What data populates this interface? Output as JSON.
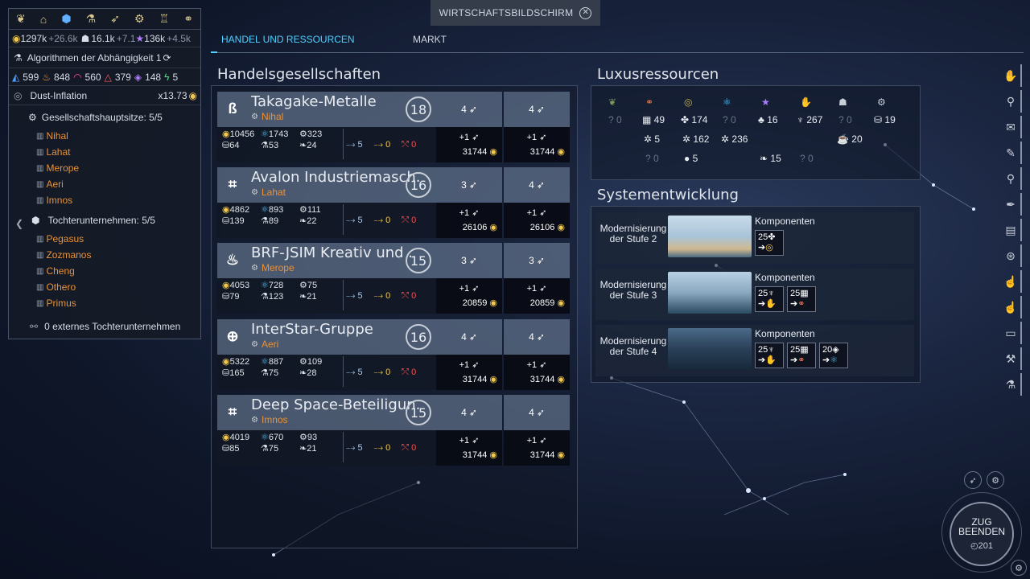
{
  "top_title": "WIRTSCHAFTSBILDSCHIRM",
  "tabs": [
    {
      "label": "HANDEL UND RESSOURCEN",
      "active": true
    },
    {
      "label": "MARKT",
      "active": false
    }
  ],
  "left_panel": {
    "top_icons": [
      "laurel-icon",
      "building-icon",
      "hexagon-icon",
      "flask-icon",
      "ship-icon",
      "gear-icon",
      "trophy-icon",
      "handshake-icon"
    ],
    "economy": {
      "dust": "1297k",
      "dust_delta": "+26.6k",
      "pop": "16.1k",
      "pop_delta": "+7.1",
      "influence": "136k",
      "influence_delta": "+4.5k"
    },
    "research": {
      "label": "Algorithmen der Abhängigkeit 1"
    },
    "strategic": [
      "599",
      "848",
      "560",
      "379",
      "148",
      "5"
    ],
    "inflation": {
      "label": "Dust-Inflation",
      "value": "x13.73"
    },
    "hq_section": {
      "title": "Gesellschaftshauptsitze: 5/5",
      "items": [
        "Nihal",
        "Lahat",
        "Merope",
        "Aeri",
        "Imnos"
      ]
    },
    "sub_section": {
      "title": "Tochterunternehmen: 5/5",
      "items": [
        "Pegasus",
        "Zozmanos",
        "Cheng",
        "Othero",
        "Primus"
      ]
    },
    "external": "0 externes Tochterunternehmen"
  },
  "companies_title": "Handelsgesellschaften",
  "companies": [
    {
      "name": "Takagake-Metalle",
      "hq": "Nihal",
      "level": "18",
      "logo": "ß",
      "stats": [
        "10456",
        "1743",
        "323",
        "64",
        "53",
        "24"
      ],
      "routes": [
        "5",
        "0",
        "0"
      ],
      "trade": [
        {
          "head": "4",
          "delta": "+1",
          "value": "31744"
        },
        {
          "head": "4",
          "delta": "+1",
          "value": "31744"
        }
      ]
    },
    {
      "name": "Avalon Industriemasch.",
      "hq": "Lahat",
      "level": "16",
      "logo": "⌗",
      "stats": [
        "4862",
        "893",
        "111",
        "139",
        "89",
        "22"
      ],
      "routes": [
        "5",
        "0",
        "0"
      ],
      "trade": [
        {
          "head": "3",
          "delta": "+1",
          "value": "26106"
        },
        {
          "head": "4",
          "delta": "+1",
          "value": "26106"
        }
      ]
    },
    {
      "name": "BRF-JSIM Kreativ und .",
      "hq": "Merope",
      "level": "15",
      "logo": "♨",
      "stats": [
        "4053",
        "728",
        "75",
        "79",
        "123",
        "21"
      ],
      "routes": [
        "5",
        "0",
        "0"
      ],
      "trade": [
        {
          "head": "3",
          "delta": "+1",
          "value": "20859"
        },
        {
          "head": "3",
          "delta": "+1",
          "value": "20859"
        }
      ]
    },
    {
      "name": "InterStar-Gruppe",
      "hq": "Aeri",
      "level": "16",
      "logo": "⊕",
      "stats": [
        "5322",
        "887",
        "109",
        "165",
        "75",
        "28"
      ],
      "routes": [
        "5",
        "0",
        "0"
      ],
      "trade": [
        {
          "head": "4",
          "delta": "+1",
          "value": "31744"
        },
        {
          "head": "4",
          "delta": "+1",
          "value": "31744"
        }
      ]
    },
    {
      "name": "Deep Space-Beteiligun.",
      "hq": "Imnos",
      "level": "15",
      "logo": "⌗",
      "stats": [
        "4019",
        "670",
        "93",
        "85",
        "75",
        "21"
      ],
      "routes": [
        "5",
        "0",
        "0"
      ],
      "trade": [
        {
          "head": "4",
          "delta": "+1",
          "value": "31744"
        },
        {
          "head": "4",
          "delta": "+1",
          "value": "31744"
        }
      ]
    }
  ],
  "luxury_title": "Luxusressourcen",
  "luxury": {
    "row1": [
      "? 0",
      "49",
      "174",
      "? 0",
      "16",
      "267",
      "? 0",
      "19"
    ],
    "row2": [
      "5",
      "162",
      "236",
      "20"
    ],
    "row3": [
      "? 0",
      "5",
      "15",
      "? 0"
    ]
  },
  "sysdev_title": "Systementwicklung",
  "sysdev": [
    {
      "label": "Modernisierung der Stufe 2",
      "components_label": "Komponenten",
      "components": [
        "25"
      ]
    },
    {
      "label": "Modernisierung der Stufe 3",
      "components_label": "Komponenten",
      "components": [
        "25",
        "25"
      ]
    },
    {
      "label": "Modernisierung der Stufe 4",
      "components_label": "Komponenten",
      "components": [
        "25",
        "25",
        "20"
      ]
    }
  ],
  "end_turn": {
    "line1": "ZUG",
    "line2": "BEENDEN",
    "turn": "201"
  },
  "colors": {
    "accent": "#4fd0ff",
    "orange": "#e8923a",
    "gold": "#f2c94c",
    "red": "#ff4d4d"
  }
}
